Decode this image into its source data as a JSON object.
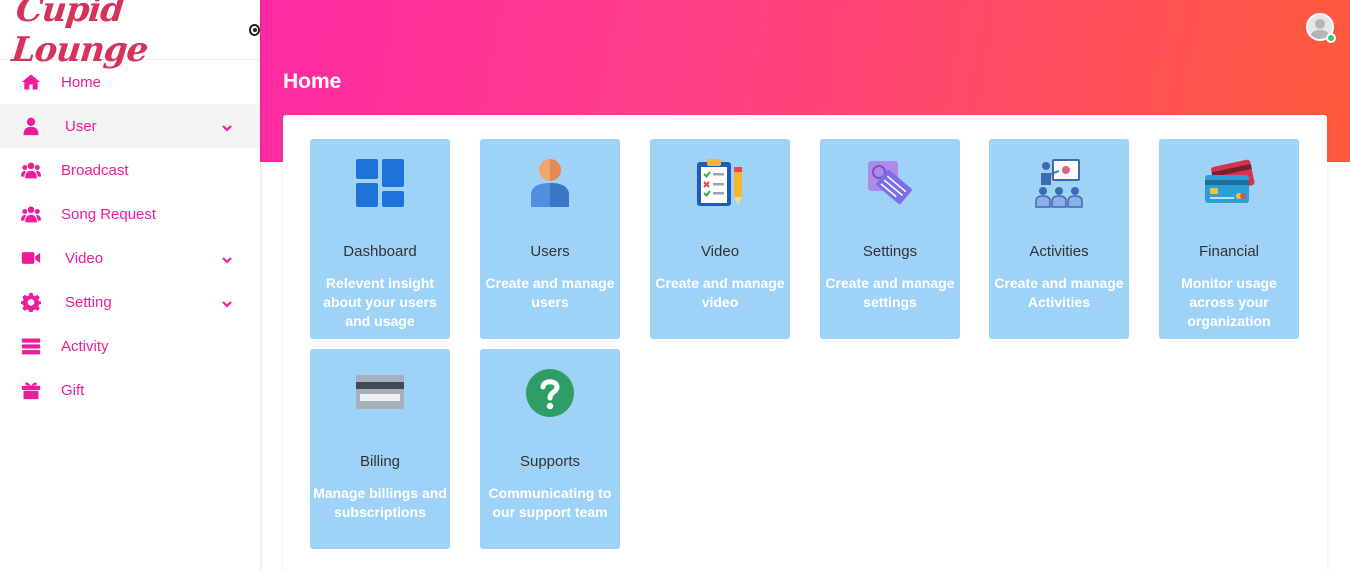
{
  "brand": {
    "name": "Cupid Lounge"
  },
  "sidebar": {
    "items": [
      {
        "label": "Home",
        "icon": "home-icon"
      },
      {
        "label": "User",
        "icon": "user-icon",
        "has_submenu": true
      },
      {
        "label": "Broadcast",
        "icon": "users-group-icon"
      },
      {
        "label": "Song Request",
        "icon": "users-group-icon"
      },
      {
        "label": "Video",
        "icon": "video-camera-icon",
        "has_submenu": true
      },
      {
        "label": "Setting",
        "icon": "gear-icon",
        "has_submenu": true
      },
      {
        "label": "Activity",
        "icon": "list-stack-icon"
      },
      {
        "label": "Gift",
        "icon": "gift-icon"
      }
    ],
    "active_index": 1
  },
  "header": {
    "title": "Home"
  },
  "colors": {
    "accent": "#ee1c9a",
    "card_bg": "#9fd2f7",
    "gradient_start": "#ff2aa3",
    "gradient_end": "#ff5a3c",
    "online": "#2ecc71"
  },
  "cards": [
    {
      "title": "Dashboard",
      "desc": "Relevent insight about your users and usage",
      "icon": "dashboard-tiles-icon"
    },
    {
      "title": "Users",
      "desc": "Create and manage users",
      "icon": "user-person-icon"
    },
    {
      "title": "Video",
      "desc": "Create and manage video",
      "icon": "clipboard-checklist-icon"
    },
    {
      "title": "Settings",
      "desc": "Create and manage settings",
      "icon": "blueprint-settings-icon"
    },
    {
      "title": "Activities",
      "desc": "Create and manage Activities",
      "icon": "presentation-group-icon"
    },
    {
      "title": "Financial",
      "desc": "Monitor usage across your organization",
      "icon": "credit-cards-icon"
    },
    {
      "title": "Billing",
      "desc": "Manage billings and subscriptions",
      "icon": "billing-card-icon"
    },
    {
      "title": "Supports",
      "desc": "Communicating to our support team",
      "icon": "question-circle-icon"
    }
  ]
}
